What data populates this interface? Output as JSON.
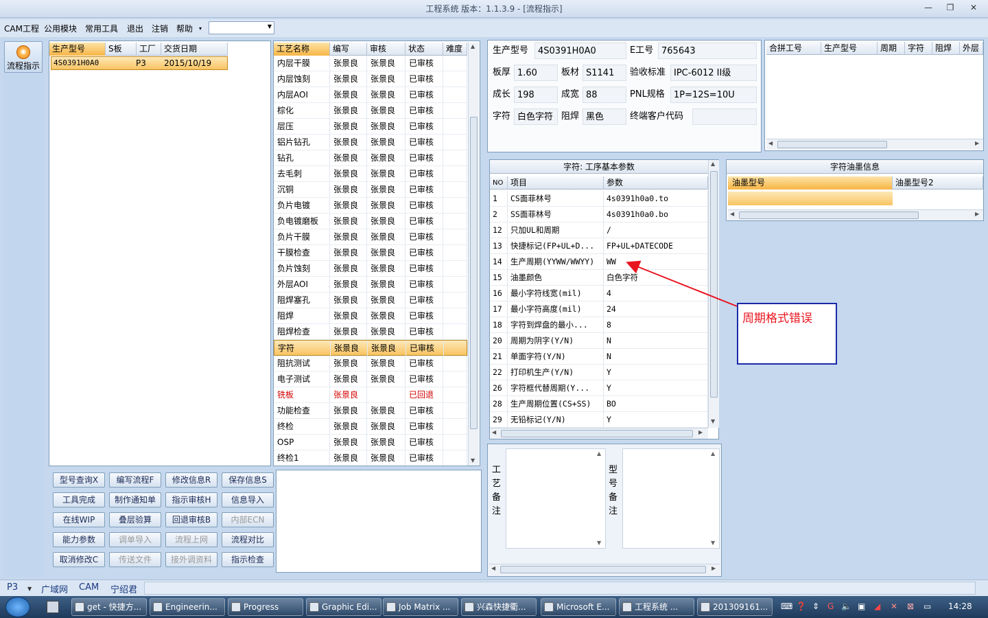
{
  "window": {
    "title": "工程系统   版本：1.1.3.9 - [流程指示]"
  },
  "menu": [
    "CAM工程",
    "公用模块",
    "常用工具",
    "退出",
    "注销",
    "帮助"
  ],
  "menu_more": "▾",
  "leftbar": {
    "button": "流程指示"
  },
  "orders": {
    "headers": [
      "生产型号",
      "S板",
      "工厂",
      "交货日期"
    ],
    "rows": [
      [
        "4S0391H0A0",
        "",
        "P3",
        "2015/10/19"
      ]
    ]
  },
  "process": {
    "headers": [
      "工艺名称",
      "编写",
      "审核",
      "状态",
      "难度"
    ],
    "rows": [
      [
        "内层干膜",
        "张景良",
        "张景良",
        "已审核",
        ""
      ],
      [
        "内层蚀刻",
        "张景良",
        "张景良",
        "已审核",
        ""
      ],
      [
        "内层AOI",
        "张景良",
        "张景良",
        "已审核",
        ""
      ],
      [
        "棕化",
        "张景良",
        "张景良",
        "已审核",
        ""
      ],
      [
        "层压",
        "张景良",
        "张景良",
        "已审核",
        ""
      ],
      [
        "铝片钻孔",
        "张景良",
        "张景良",
        "已审核",
        ""
      ],
      [
        "钻孔",
        "张景良",
        "张景良",
        "已审核",
        ""
      ],
      [
        "去毛刺",
        "张景良",
        "张景良",
        "已审核",
        ""
      ],
      [
        "沉铜",
        "张景良",
        "张景良",
        "已审核",
        ""
      ],
      [
        "负片电镀",
        "张景良",
        "张景良",
        "已审核",
        ""
      ],
      [
        "负电镀磨板",
        "张景良",
        "张景良",
        "已审核",
        ""
      ],
      [
        "负片干膜",
        "张景良",
        "张景良",
        "已审核",
        ""
      ],
      [
        "干膜检查",
        "张景良",
        "张景良",
        "已审核",
        ""
      ],
      [
        "负片蚀刻",
        "张景良",
        "张景良",
        "已审核",
        ""
      ],
      [
        "外层AOI",
        "张景良",
        "张景良",
        "已审核",
        ""
      ],
      [
        "阻焊塞孔",
        "张景良",
        "张景良",
        "已审核",
        ""
      ],
      [
        "阻焊",
        "张景良",
        "张景良",
        "已审核",
        ""
      ],
      [
        "阻焊检查",
        "张景良",
        "张景良",
        "已审核",
        ""
      ],
      [
        "字符",
        "张景良",
        "张景良",
        "已审核",
        ""
      ],
      [
        "阻抗测试",
        "张景良",
        "张景良",
        "已审核",
        ""
      ],
      [
        "电子测试",
        "张景良",
        "张景良",
        "已审核",
        ""
      ],
      [
        "铣板",
        "张景良",
        "",
        "已回退",
        ""
      ],
      [
        "功能检查",
        "张景良",
        "张景良",
        "已审核",
        ""
      ],
      [
        "终检",
        "张景良",
        "张景良",
        "已审核",
        ""
      ],
      [
        "OSP",
        "张景良",
        "张景良",
        "已审核",
        ""
      ],
      [
        "终检1",
        "张景良",
        "张景良",
        "已审核",
        ""
      ]
    ]
  },
  "buttons": [
    [
      "型号查询X",
      "编写流程F",
      "修改信息R",
      "保存信息S"
    ],
    [
      "工具完成",
      "制作通知单",
      "指示审核H",
      "信息导入"
    ],
    [
      "在线WIP",
      "叠层验算",
      "回退审核B",
      "内部ECN"
    ],
    [
      "能力参数",
      "调单导入",
      "流程上网",
      "流程对比"
    ],
    [
      "取消修改C",
      "传送文件",
      "接外调资料",
      "指示检查"
    ]
  ],
  "info": {
    "prod_model_label": "生产型号",
    "prod_model": "4S0391H0A0",
    "eno_label": "E工号",
    "eno": "765643",
    "thick_label": "板厚",
    "thick": "1.60",
    "material_label": "板材",
    "material": "S1141",
    "std_label": "验收标准",
    "std": "IPC-6012 II级",
    "len_label": "成长",
    "len": "198",
    "wid_label": "成宽",
    "wid": "88",
    "pnl_label": "PNL规格",
    "pnl": "1P=12S=10U",
    "char_label": "字符",
    "char": "白色字符",
    "mask_label": "阻焊",
    "mask": "黑色",
    "cust_label": "终端客户代码",
    "cust": ""
  },
  "combine": {
    "headers": [
      "合拼工号",
      "生产型号",
      "周期",
      "字符",
      "阻焊",
      "外层"
    ]
  },
  "params": {
    "title": "字符: 工序基本参数",
    "headers": [
      "NO",
      "项目",
      "参数"
    ],
    "rows": [
      [
        "1",
        "CS面菲林号",
        "4s0391h0a0.to"
      ],
      [
        "2",
        "SS面菲林号",
        "4s0391h0a0.bo"
      ],
      [
        "12",
        "只加UL和周期",
        "/"
      ],
      [
        "13",
        "快捷标记(FP+UL+D...",
        "FP+UL+DATECODE"
      ],
      [
        "14",
        "生产周期(YYWW/WWYY)",
        "WW"
      ],
      [
        "15",
        "油墨颜色",
        "白色字符"
      ],
      [
        "16",
        "最小字符线宽(mil)",
        "4"
      ],
      [
        "17",
        "最小字符高度(mil)",
        "24"
      ],
      [
        "18",
        "字符到焊盘的最小...",
        "8"
      ],
      [
        "20",
        "周期为阴字(Y/N)",
        "N"
      ],
      [
        "21",
        "单面字符(Y/N)",
        "N"
      ],
      [
        "22",
        "打印机生产(Y/N)",
        "Y"
      ],
      [
        "26",
        "字符框代替周期(Y...",
        "Y"
      ],
      [
        "28",
        "生产周期位置(CS+SS)",
        "BO"
      ],
      [
        "29",
        "无铅标记(Y/N)",
        "Y"
      ]
    ]
  },
  "ink": {
    "title": "字符油墨信息",
    "headers": [
      "油墨型号",
      "油墨型号2"
    ]
  },
  "remarks": {
    "process": "工艺备注",
    "model": "型号备注"
  },
  "annotation": {
    "text": "周期格式错误",
    "color": "#e8141e"
  },
  "statusbar": [
    "P3",
    "广域网",
    "CAM",
    "宁绍君"
  ],
  "taskbar": {
    "items": [
      "get - 快捷方...",
      "Engineerin...",
      "Progress",
      "Graphic Edi...",
      "Job Matrix ...",
      "兴森快捷衢...",
      "Microsoft E...",
      "工程系统  ...",
      "201309161..."
    ],
    "clock": "14:28"
  }
}
